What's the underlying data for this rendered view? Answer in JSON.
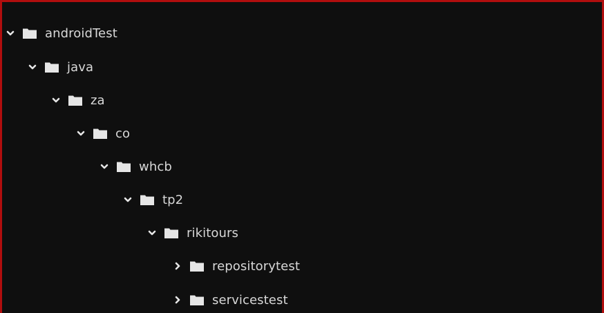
{
  "tree": {
    "items": [
      {
        "label": "androidTest",
        "expanded": true
      },
      {
        "label": "java",
        "expanded": true
      },
      {
        "label": "za",
        "expanded": true
      },
      {
        "label": "co",
        "expanded": true
      },
      {
        "label": "whcb",
        "expanded": true
      },
      {
        "label": "tp2",
        "expanded": true
      },
      {
        "label": "rikitours",
        "expanded": true
      },
      {
        "label": "repositorytest",
        "expanded": false
      },
      {
        "label": "servicestest",
        "expanded": false
      }
    ]
  },
  "icons": {
    "expanded": "chevron-down-icon",
    "collapsed": "chevron-right-icon",
    "folder": "folder-icon"
  },
  "colors": {
    "background": "#0f0f0f",
    "border": "#b10e0e",
    "text": "#d8d8d8",
    "icon": "#e6e6e6"
  }
}
